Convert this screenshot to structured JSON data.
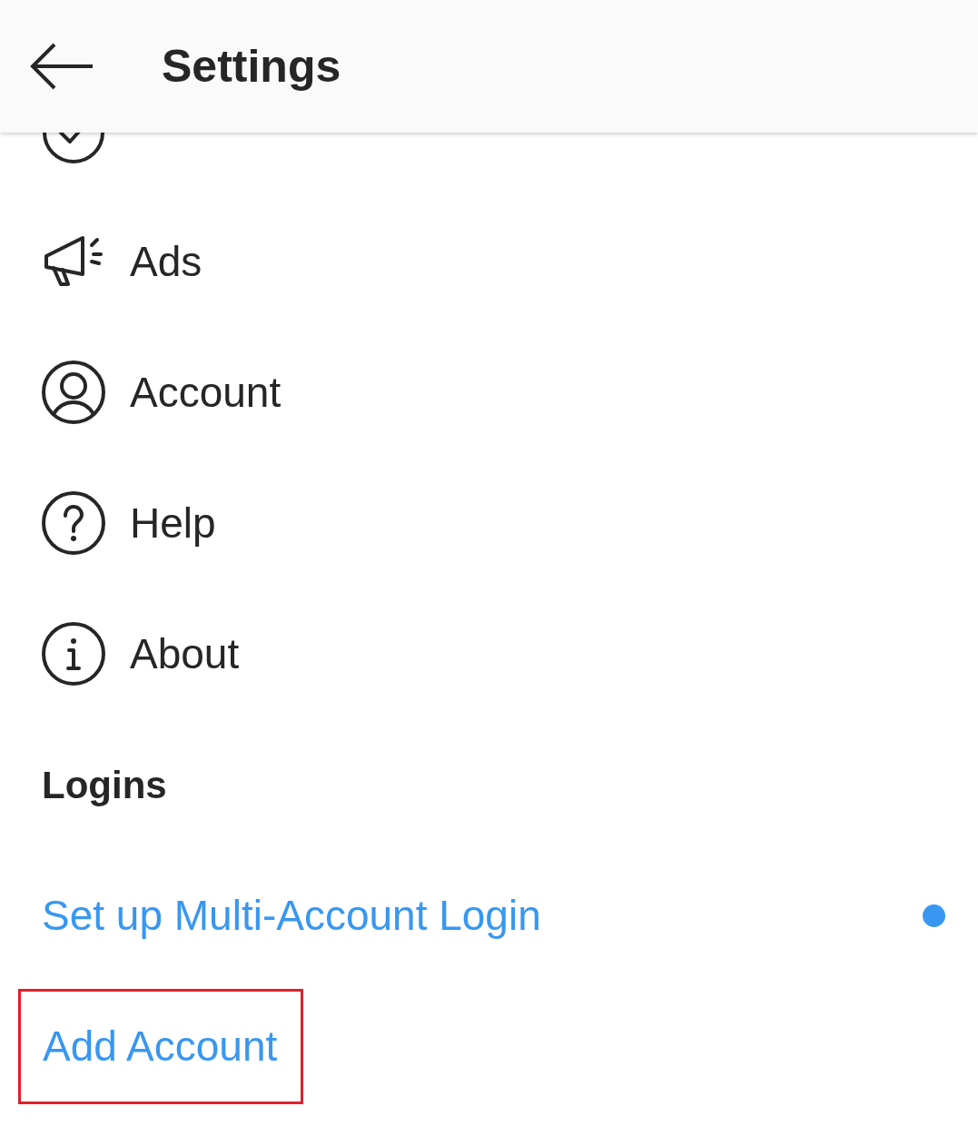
{
  "header": {
    "title": "Settings"
  },
  "menu": [
    {
      "kind": "security"
    },
    {
      "label": "Ads",
      "kind": "ads"
    },
    {
      "label": "Account",
      "kind": "account"
    },
    {
      "label": "Help",
      "kind": "help"
    },
    {
      "label": "About",
      "kind": "about"
    }
  ],
  "logins": {
    "title": "Logins",
    "links": [
      {
        "label": "Set up Multi-Account Login",
        "dot": true,
        "highlighted": false
      },
      {
        "label": "Add Account",
        "dot": false,
        "highlighted": true
      }
    ]
  }
}
